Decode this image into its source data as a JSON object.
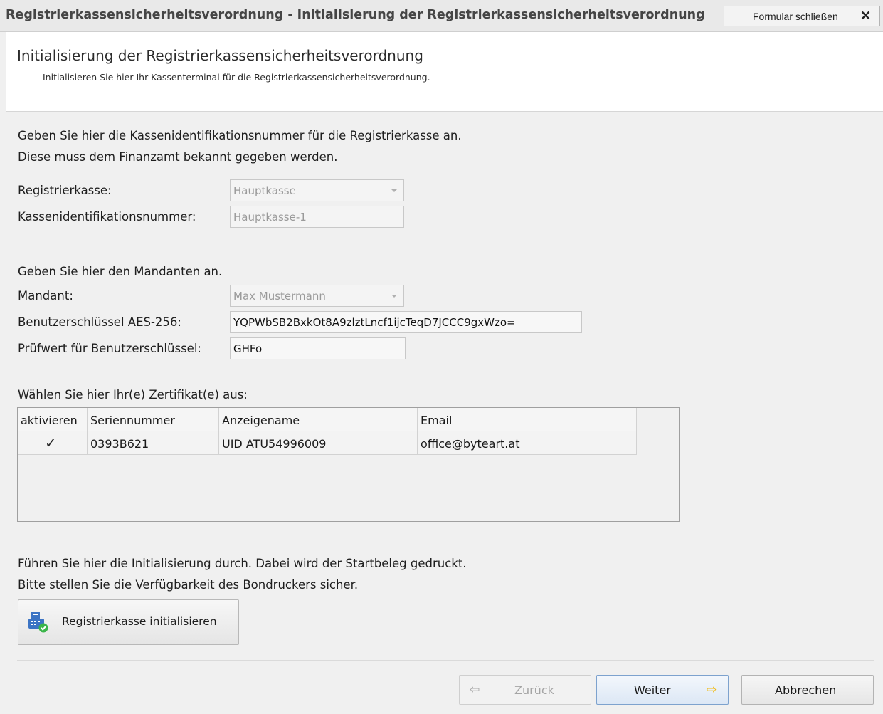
{
  "window": {
    "title": "Registrierkassensicherheitsverordnung - Initialisierung der Registrierkassensicherheitsverordnung",
    "close_label": "Formular schließen",
    "close_glyph": "✕"
  },
  "header": {
    "title": "Initialisierung der Registrierkassensicherheitsverordnung",
    "subtitle": "Initialisieren Sie hier Ihr Kassenterminal für die Registrierkassensicherheitsverordnung."
  },
  "section_register": {
    "intro_line1": "Geben Sie hier die Kassenidentifikationsnummer für die Registrierkasse an.",
    "intro_line2": "Diese muss dem Finanzamt bekannt gegeben werden.",
    "register_label": "Registrierkasse:",
    "register_value": "Hauptkasse",
    "id_label": "Kassenidentifikationsnummer:",
    "id_value": "Hauptkasse-1"
  },
  "section_client": {
    "intro": "Geben Sie hier den Mandanten an.",
    "client_label": "Mandant:",
    "client_value": "Max Mustermann",
    "key_label": "Benutzerschlüssel AES-256:",
    "key_value": "YQPWbSB2BxkOt8A9zlztLncf1ijcTeqD7JCCC9gxWzo=",
    "check_label": "Prüfwert für Benutzerschlüssel:",
    "check_value": "GHFo"
  },
  "section_certs": {
    "intro": "Wählen Sie hier Ihr(e) Zertifikat(e) aus:",
    "columns": [
      "aktivieren",
      "Seriennummer",
      "Anzeigename",
      "Email"
    ],
    "rows": [
      {
        "checked": "✓",
        "serial": "0393B621",
        "display_name": "UID ATU54996009",
        "email": "office@byteart.at"
      }
    ]
  },
  "section_init": {
    "line1": "Führen Sie hier die Initialisierung durch. Dabei wird der Startbeleg gedruckt.",
    "line2": "Bitte stellen Sie die Verfügbarkeit des Bondruckers sicher.",
    "button_label": "Registrierkasse initialisieren",
    "button_icon": "cash-register-icon"
  },
  "nav": {
    "back_label": "Zurück",
    "next_label": "Weiter",
    "cancel_label": "Abbrechen",
    "back_glyph": "⇦",
    "next_glyph": "⇨"
  },
  "colors": {
    "accent_arrow": "#f2b705",
    "default_border": "#7da2ce"
  }
}
